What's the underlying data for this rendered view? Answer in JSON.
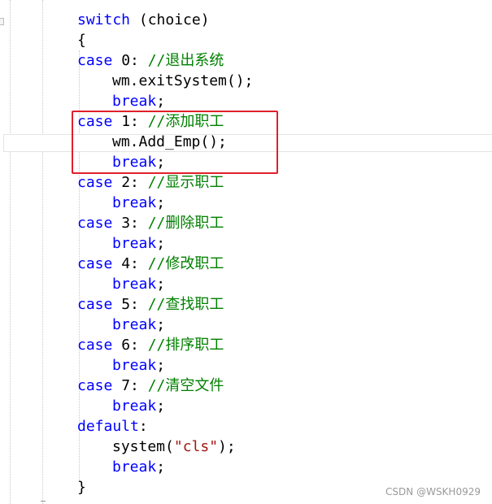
{
  "editor": {
    "lines": [
      {
        "indent": 95,
        "tokens": [
          {
            "t": "switch",
            "c": "kw"
          },
          {
            "t": " (choice)",
            "c": "plain"
          }
        ]
      },
      {
        "indent": 95,
        "tokens": [
          {
            "t": "{",
            "c": "plain"
          }
        ]
      },
      {
        "indent": 95,
        "tokens": [
          {
            "t": "case",
            "c": "kw"
          },
          {
            "t": " 0: ",
            "c": "plain"
          },
          {
            "t": "//退出系统",
            "c": "cm"
          }
        ]
      },
      {
        "indent": 138,
        "tokens": [
          {
            "t": "wm.exitSystem();",
            "c": "plain"
          }
        ]
      },
      {
        "indent": 138,
        "tokens": [
          {
            "t": "break",
            "c": "kw"
          },
          {
            "t": ";",
            "c": "plain"
          }
        ]
      },
      {
        "indent": 95,
        "tokens": [
          {
            "t": "case",
            "c": "kw"
          },
          {
            "t": " 1: ",
            "c": "plain"
          },
          {
            "t": "//添加职工",
            "c": "cm"
          }
        ]
      },
      {
        "indent": 138,
        "tokens": [
          {
            "t": "wm.Add_Emp();",
            "c": "plain"
          }
        ]
      },
      {
        "indent": 138,
        "tokens": [
          {
            "t": "break",
            "c": "kw"
          },
          {
            "t": ";",
            "c": "plain"
          }
        ]
      },
      {
        "indent": 95,
        "tokens": [
          {
            "t": "case",
            "c": "kw"
          },
          {
            "t": " 2: ",
            "c": "plain"
          },
          {
            "t": "//显示职工",
            "c": "cm"
          }
        ]
      },
      {
        "indent": 138,
        "tokens": [
          {
            "t": "break",
            "c": "kw"
          },
          {
            "t": ";",
            "c": "plain"
          }
        ]
      },
      {
        "indent": 95,
        "tokens": [
          {
            "t": "case",
            "c": "kw"
          },
          {
            "t": " 3: ",
            "c": "plain"
          },
          {
            "t": "//删除职工",
            "c": "cm"
          }
        ]
      },
      {
        "indent": 138,
        "tokens": [
          {
            "t": "break",
            "c": "kw"
          },
          {
            "t": ";",
            "c": "plain"
          }
        ]
      },
      {
        "indent": 95,
        "tokens": [
          {
            "t": "case",
            "c": "kw"
          },
          {
            "t": " 4: ",
            "c": "plain"
          },
          {
            "t": "//修改职工",
            "c": "cm"
          }
        ]
      },
      {
        "indent": 138,
        "tokens": [
          {
            "t": "break",
            "c": "kw"
          },
          {
            "t": ";",
            "c": "plain"
          }
        ]
      },
      {
        "indent": 95,
        "tokens": [
          {
            "t": "case",
            "c": "kw"
          },
          {
            "t": " 5: ",
            "c": "plain"
          },
          {
            "t": "//查找职工",
            "c": "cm"
          }
        ]
      },
      {
        "indent": 138,
        "tokens": [
          {
            "t": "break",
            "c": "kw"
          },
          {
            "t": ";",
            "c": "plain"
          }
        ]
      },
      {
        "indent": 95,
        "tokens": [
          {
            "t": "case",
            "c": "kw"
          },
          {
            "t": " 6: ",
            "c": "plain"
          },
          {
            "t": "//排序职工",
            "c": "cm"
          }
        ]
      },
      {
        "indent": 138,
        "tokens": [
          {
            "t": "break",
            "c": "kw"
          },
          {
            "t": ";",
            "c": "plain"
          }
        ]
      },
      {
        "indent": 95,
        "tokens": [
          {
            "t": "case",
            "c": "kw"
          },
          {
            "t": " 7: ",
            "c": "plain"
          },
          {
            "t": "//清空文件",
            "c": "cm"
          }
        ]
      },
      {
        "indent": 138,
        "tokens": [
          {
            "t": "break",
            "c": "kw"
          },
          {
            "t": ";",
            "c": "plain"
          }
        ]
      },
      {
        "indent": 95,
        "tokens": [
          {
            "t": "default",
            "c": "kw"
          },
          {
            "t": ":",
            "c": "plain"
          }
        ]
      },
      {
        "indent": 138,
        "tokens": [
          {
            "t": "system(",
            "c": "plain"
          },
          {
            "t": "\"cls\"",
            "c": "str"
          },
          {
            "t": ");",
            "c": "plain"
          }
        ]
      },
      {
        "indent": 138,
        "tokens": [
          {
            "t": "break",
            "c": "kw"
          },
          {
            "t": ";",
            "c": "plain"
          }
        ]
      },
      {
        "indent": 95,
        "tokens": [
          {
            "t": "}",
            "c": "plain"
          }
        ]
      }
    ]
  },
  "highlight": {
    "color": "#e0202a"
  },
  "watermark": {
    "text": "CSDN @WSKH0929"
  },
  "colors": {
    "keyword": "#0000ff",
    "comment": "#008000",
    "string": "#a31515",
    "text": "#000000"
  }
}
